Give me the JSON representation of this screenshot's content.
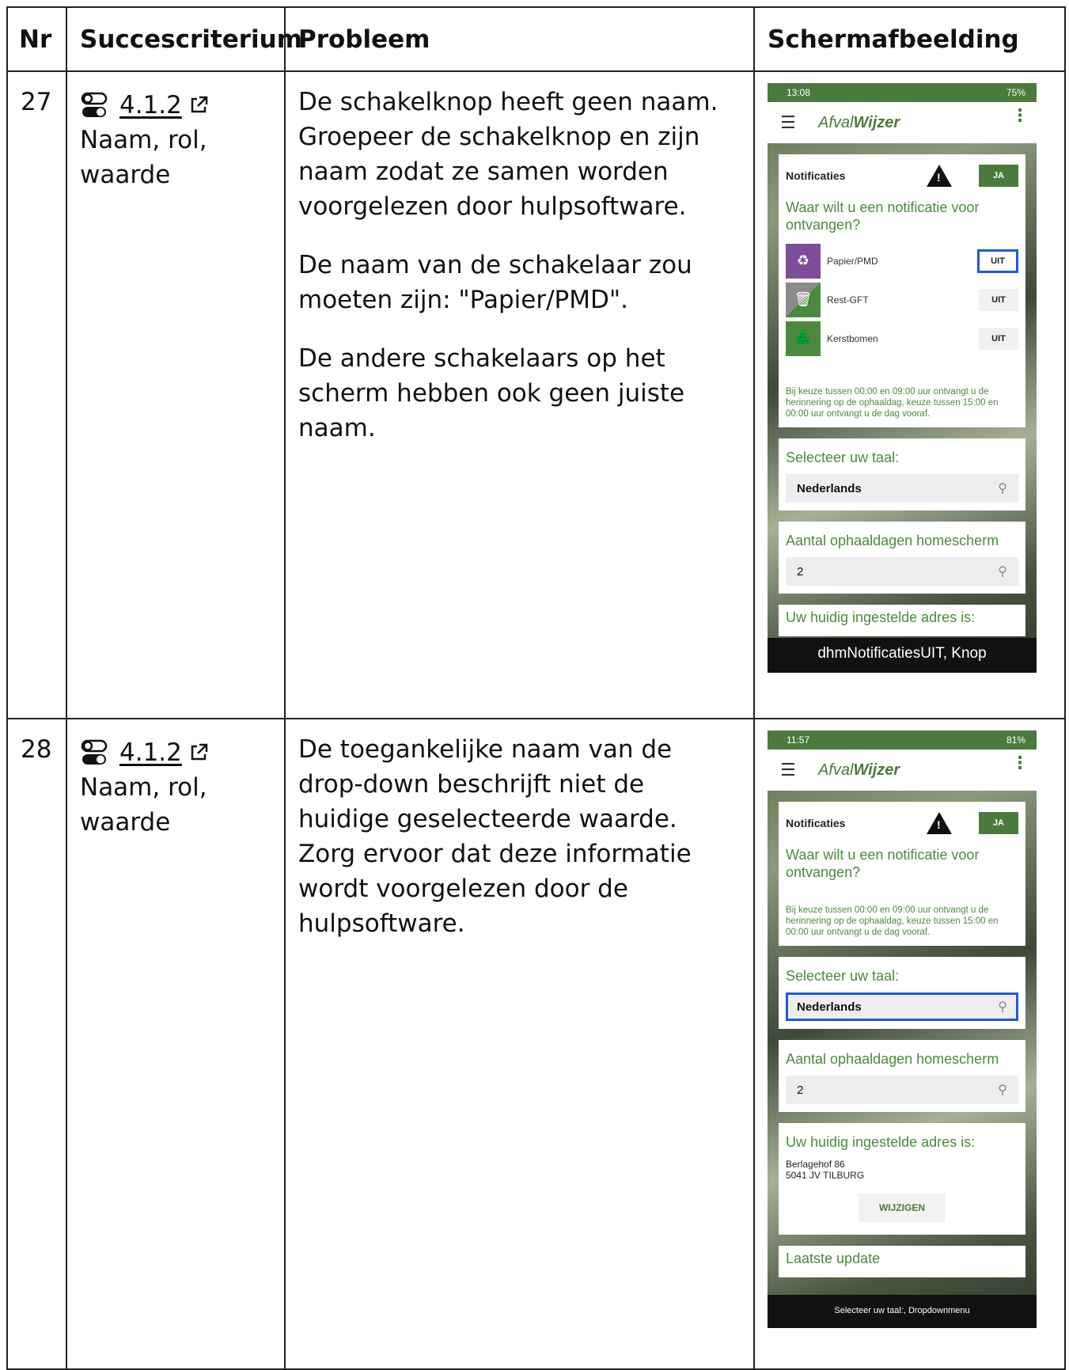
{
  "table": {
    "headers": {
      "nr": "Nr",
      "criterion": "Succescriterium",
      "problem": "Probleem",
      "screenshot": "Schermafbeelding"
    }
  },
  "rows": [
    {
      "nr": "27",
      "criterion_code": "4.1.2",
      "criterion_name": "Naam, rol, waarde",
      "problem": [
        "De schakelknop heeft geen naam. Groepeer de schakelknop en zijn naam zodat ze samen worden voorgelezen door hulpsoftware.",
        "De naam van de schakelaar zou moeten zijn: \"Papier/PMD\".",
        "De andere schakelaars op het scherm hebben ook geen juiste naam."
      ],
      "phone": {
        "time": "13:08",
        "battery": "75%",
        "logo_a": "Afval",
        "logo_b": "Wijzer",
        "notif_title": "Notificaties",
        "ja": "JA",
        "question": "Waar wilt u een notificatie voor ontvangen?",
        "options": [
          {
            "label": "Papier/PMD",
            "value": "UIT"
          },
          {
            "label": "Rest-GFT",
            "value": "UIT"
          },
          {
            "label": "Kerstbomen",
            "value": "UIT"
          }
        ],
        "info": "Bij keuze tussen 00:00 en 09:00 uur ontvangt u de herinnering op de ophaaldag, keuze tussen 15:00 en 00:00 uur ontvangt u de dag vooraf.",
        "lang_label": "Selecteer uw taal:",
        "lang_value": "Nederlands",
        "days_label": "Aantal ophaaldagen homescherm",
        "days_value": "2",
        "partial_label": "Uw huidig ingestelde adres is:",
        "caption": "dhmNotificatiesUIT, Knop"
      }
    },
    {
      "nr": "28",
      "criterion_code": "4.1.2",
      "criterion_name": "Naam, rol, waarde",
      "problem": [
        "De toegankelijke naam van de drop-down beschrijft niet de huidige geselecteerde waarde. Zorg ervoor dat deze informatie wordt voorgelezen door de hulpsoftware."
      ],
      "phone": {
        "time": "11:57",
        "battery": "81%",
        "logo_a": "Afval",
        "logo_b": "Wijzer",
        "notif_title": "Notificaties",
        "ja": "JA",
        "question": "Waar wilt u een notificatie voor ontvangen?",
        "info": "Bij keuze tussen 00:00 en 09:00 uur ontvangt u de herinnering op de ophaaldag, keuze tussen 15:00 en 00:00 uur ontvangt u de dag vooraf.",
        "lang_label": "Selecteer uw taal:",
        "lang_value": "Nederlands",
        "days_label": "Aantal ophaaldagen homescherm",
        "days_value": "2",
        "address_label": "Uw huidig ingestelde adres is:",
        "address_line1": "Berlagehof 86",
        "address_line2": "5041 JV TILBURG",
        "wijzigen": "WIJZIGEN",
        "partial_label": "Laatste update",
        "caption": "Selecteer uw taal:, Dropdownmenu"
      }
    }
  ]
}
